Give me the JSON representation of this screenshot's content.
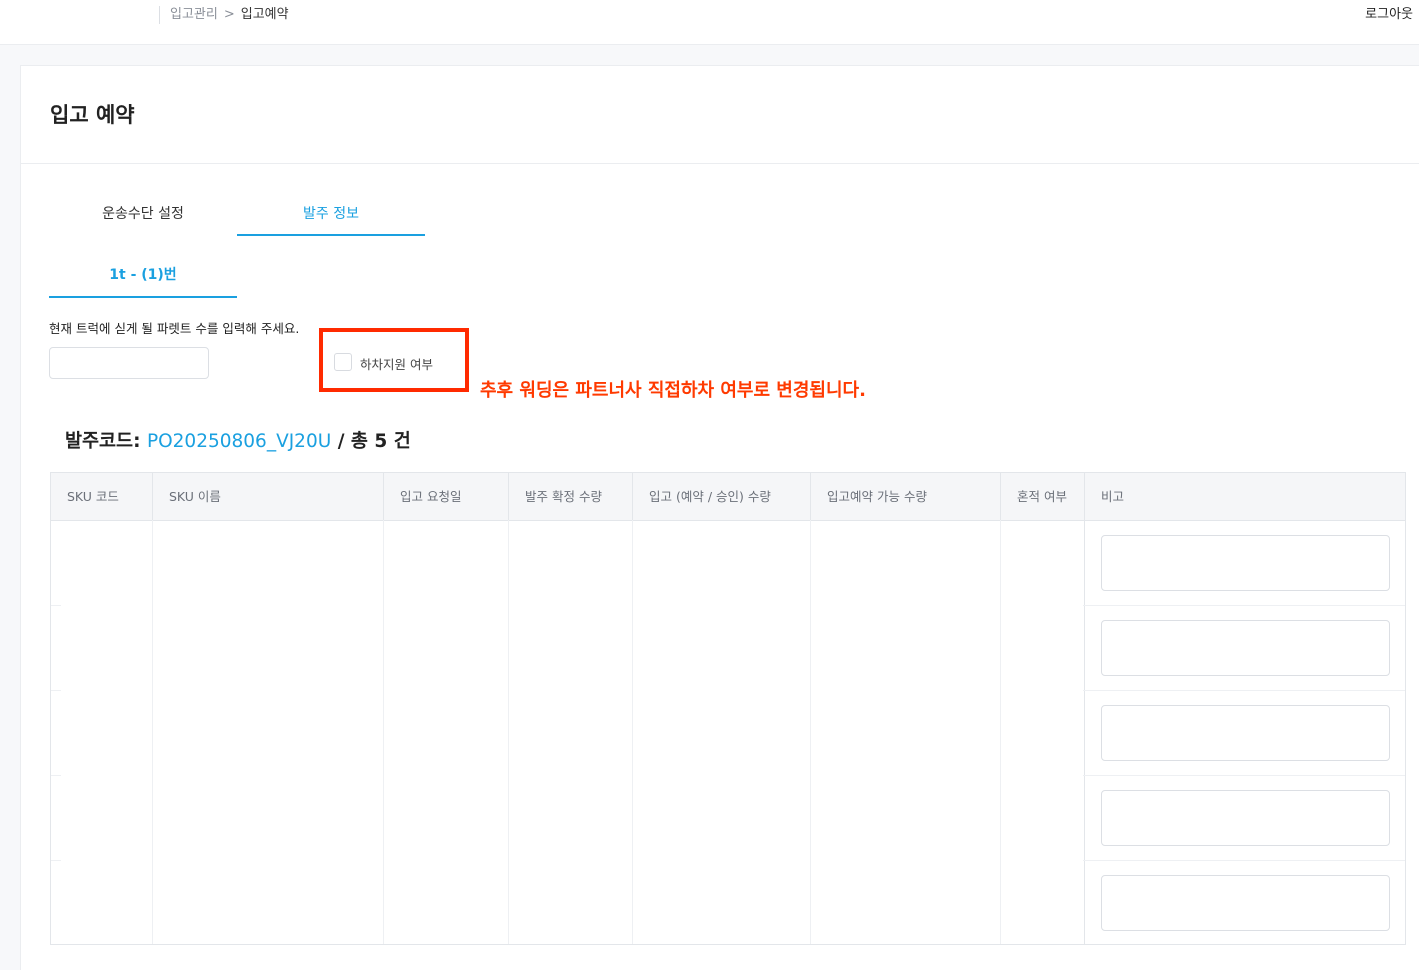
{
  "breadcrumb": {
    "parent": "입고관리",
    "separator": ">",
    "current": "입고예약"
  },
  "header": {
    "logout_label": "로그아웃"
  },
  "page": {
    "title": "입고 예약"
  },
  "tabs": [
    {
      "label": "운송수단 설정",
      "active": false
    },
    {
      "label": "발주 정보",
      "active": true
    }
  ],
  "subtab": {
    "label": "1t - (1)번"
  },
  "pallet": {
    "label": "현재 트럭에 싣게 될 파렛트 수를 입력해 주세요.",
    "value": "",
    "placeholder": ""
  },
  "unloading": {
    "label": "하차지원 여부",
    "checked": false
  },
  "annotation": {
    "note": "추후 워딩은 파트너사 직접하차 여부로 변경됩니다.",
    "color": "#ff2a00"
  },
  "po": {
    "prefix": "발주코드:",
    "code": "PO20250806_VJ20U",
    "count_text": "/ 총 5 건"
  },
  "table": {
    "headers": [
      "SKU 코드",
      "SKU 이름",
      "입고 요청일",
      "발주 확정 수량",
      "입고 (예약 / 승인) 수량",
      "입고예약 가능 수량",
      "혼적 여부",
      "비고"
    ],
    "rows": [
      {
        "note": ""
      },
      {
        "note": ""
      },
      {
        "note": ""
      },
      {
        "note": ""
      },
      {
        "note": ""
      }
    ]
  },
  "colors": {
    "accent": "#1aa0e0",
    "annotation": "#ff3a00",
    "border": "#e3e6ea"
  }
}
